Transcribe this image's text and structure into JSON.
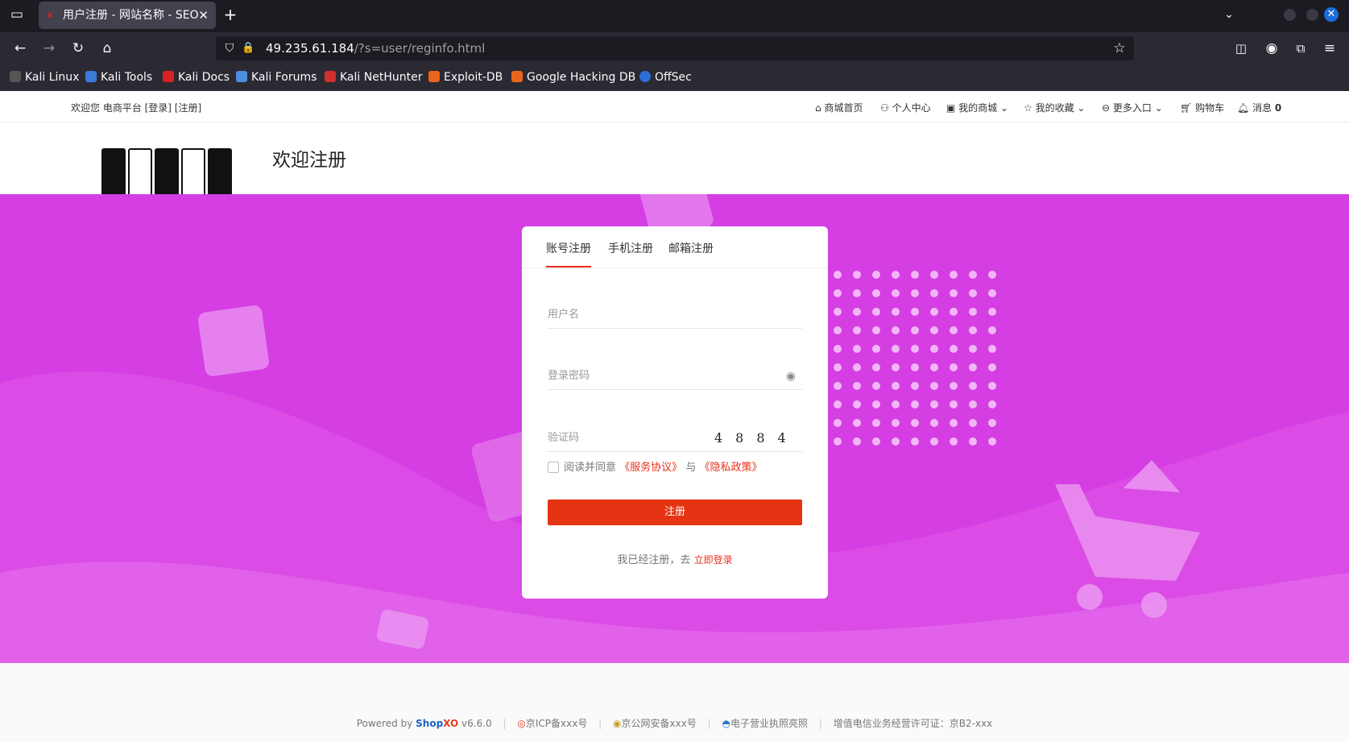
{
  "browser": {
    "tab_title": "用户注册 - 网站名称 - SEO",
    "url_host": "49.235.61.184",
    "url_path": "/?s=user/reginfo.html",
    "bookmarks": [
      "Kali Linux",
      "Kali Tools",
      "Kali Docs",
      "Kali Forums",
      "Kali NetHunter",
      "Exploit-DB",
      "Google Hacking DB",
      "OffSec"
    ]
  },
  "topbar": {
    "welcome": "欢迎您 电商平台 [登录] [注册]",
    "nav": [
      "商城首页",
      "个人中心",
      "我的商城",
      "我的收藏",
      "更多入口",
      "购物车",
      "消息"
    ],
    "message_count": "0"
  },
  "header": {
    "title": "欢迎注册"
  },
  "register": {
    "tabs": [
      "账号注册",
      "手机注册",
      "邮箱注册"
    ],
    "username_placeholder": "用户名",
    "password_placeholder": "登录密码",
    "captcha_placeholder": "验证码",
    "captcha_code": "4884",
    "agree_prefix": "阅读并同意",
    "service_link": "《服务协议》",
    "agree_and": "与",
    "privacy_link": "《隐私政策》",
    "submit": "注册",
    "login_prompt": "我已经注册，去",
    "login_link": "立即登录"
  },
  "footer": {
    "powered_by": "Powered by",
    "brand": "Shop",
    "brand_suffix": "XO",
    "version": "v6.6.0",
    "icp": "京ICP备xxx号",
    "police": "京公网安备xxx号",
    "license": "电子营业执照亮照",
    "telecom": "增值电信业务经营许可证：京B2-xxx"
  },
  "colors": {
    "accent": "#e8321d",
    "hero_bg": "#d53ee3",
    "brand_blue": "#1a63c6"
  }
}
